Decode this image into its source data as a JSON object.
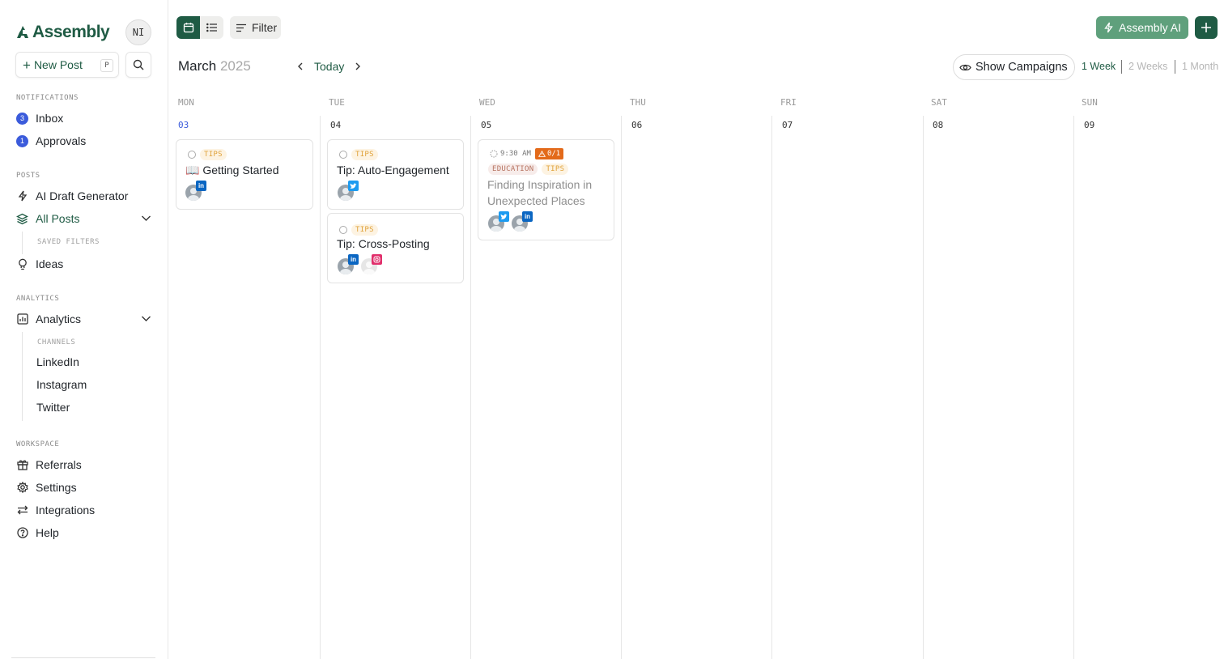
{
  "brand": {
    "name": "Assembly",
    "user_initials": "NI"
  },
  "sidebar": {
    "new_post_label": "New Post",
    "new_post_shortcut": "P",
    "notifications_label": "NOTIFICATIONS",
    "inbox": {
      "label": "Inbox",
      "count": "3"
    },
    "approvals": {
      "label": "Approvals",
      "count": "1"
    },
    "posts_label": "POSTS",
    "ai_draft_label": "AI Draft Generator",
    "all_posts_label": "All Posts",
    "saved_filters_label": "SAVED FILTERS",
    "ideas_label": "Ideas",
    "analytics_section_label": "ANALYTICS",
    "analytics_label": "Analytics",
    "channels_label": "CHANNELS",
    "channels": [
      "LinkedIn",
      "Instagram",
      "Twitter"
    ],
    "workspace_label": "WORKSPACE",
    "referrals_label": "Referrals",
    "settings_label": "Settings",
    "integrations_label": "Integrations",
    "help_label": "Help"
  },
  "toolbar": {
    "filter_label": "Filter",
    "ai_label": "Assembly AI"
  },
  "calendar": {
    "month": "March",
    "year": "2025",
    "today_label": "Today",
    "show_campaigns_label": "Show Campaigns",
    "ranges": [
      "1 Week",
      "2 Weeks",
      "1 Month"
    ],
    "days": [
      {
        "dow": "MON",
        "num": "03"
      },
      {
        "dow": "TUE",
        "num": "04"
      },
      {
        "dow": "WED",
        "num": "05"
      },
      {
        "dow": "THU",
        "num": "06"
      },
      {
        "dow": "FRI",
        "num": "07"
      },
      {
        "dow": "SAT",
        "num": "08"
      },
      {
        "dow": "SUN",
        "num": "09"
      }
    ]
  },
  "posts": {
    "getting_started": {
      "tag": "TIPS",
      "emoji": "📖",
      "title": "Getting Started"
    },
    "auto_engagement": {
      "tag": "TIPS",
      "title": "Tip: Auto-Engagement"
    },
    "cross_posting": {
      "tag": "TIPS",
      "title": "Tip: Cross-Posting"
    },
    "inspiration": {
      "time": "9:30 AM",
      "warning": "0/1",
      "tags": [
        "EDUCATION",
        "TIPS"
      ],
      "title_line1": "Finding Inspiration in",
      "title_line2": "Unexpected Places"
    }
  },
  "colors": {
    "brand": "#1f5b44",
    "ai_button": "#5fa07c",
    "today": "#3b5bdb",
    "tips": "#e0a23a",
    "warning": "#e36a1a"
  }
}
